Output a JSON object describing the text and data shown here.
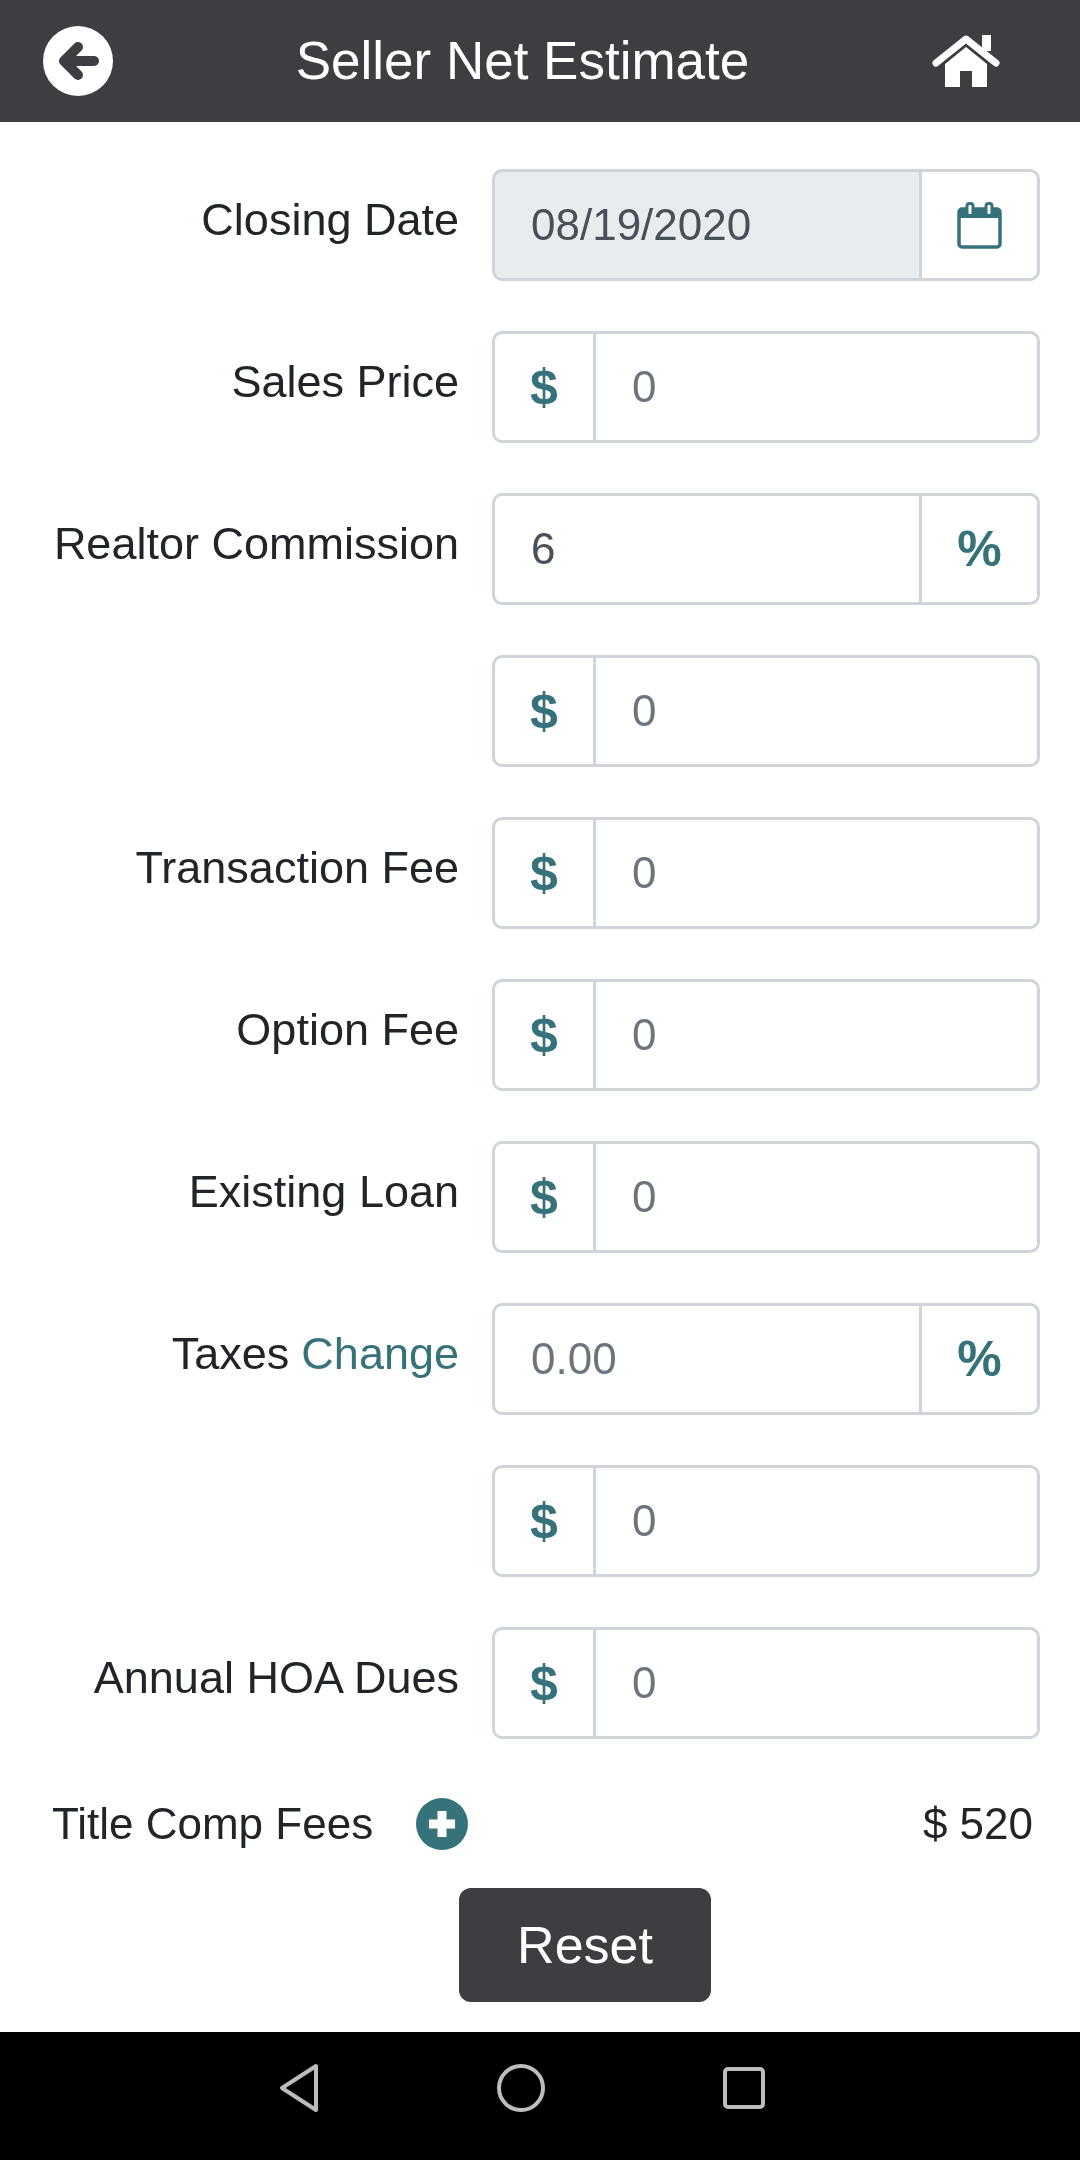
{
  "header": {
    "title": "Seller Net Estimate"
  },
  "fields": [
    {
      "kind": "date",
      "label": "Closing Date",
      "value": "08/19/2020",
      "readonly": true
    },
    {
      "kind": "prefix",
      "label": "Sales Price",
      "addon": "$",
      "placeholder": "0",
      "readonly": false
    },
    {
      "kind": "suffix",
      "label": "Realtor Commission",
      "value": "6",
      "addon": "%",
      "readonly": false
    },
    {
      "kind": "prefix",
      "addon": "$",
      "placeholder": "0",
      "readonly": false
    },
    {
      "kind": "prefix",
      "label": "Transaction Fee",
      "addon": "$",
      "placeholder": "0",
      "readonly": false
    },
    {
      "kind": "prefix",
      "label": "Option Fee",
      "addon": "$",
      "placeholder": "0",
      "readonly": false
    },
    {
      "kind": "prefix",
      "label": "Existing Loan",
      "addon": "$",
      "placeholder": "0",
      "readonly": false
    },
    {
      "kind": "suffix",
      "label": "Taxes",
      "link": "Change",
      "placeholder": "0.00",
      "addon": "%",
      "readonly": false
    },
    {
      "kind": "prefix",
      "addon": "$",
      "placeholder": "0",
      "readonly": false
    },
    {
      "kind": "prefix",
      "label": "Annual HOA Dues",
      "addon": "$",
      "placeholder": "0",
      "readonly": false
    }
  ],
  "title_comp_fees": {
    "label": "Title Comp Fees",
    "amount": "$ 520"
  },
  "reset_button": {
    "label": "Reset"
  }
}
